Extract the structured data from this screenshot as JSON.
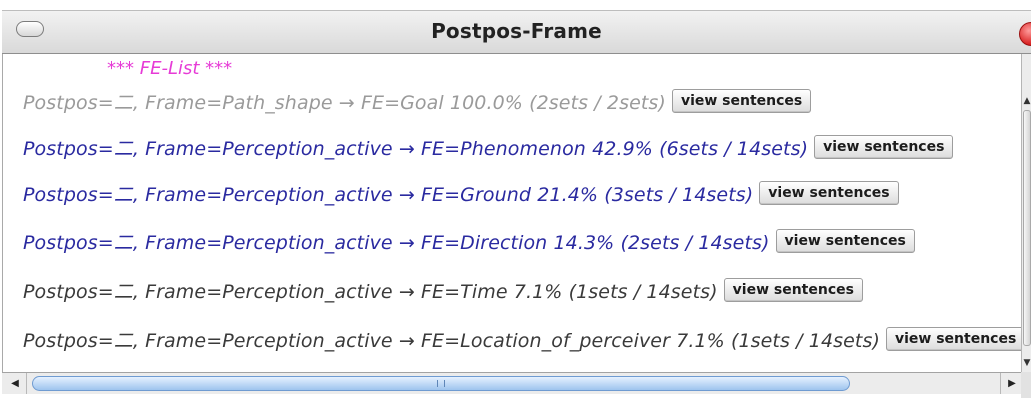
{
  "window": {
    "title": "Postpos-Frame"
  },
  "list": {
    "header": "*** FE-List ***",
    "rows": [
      {
        "text": "Postpos=二, Frame=Path_shape → FE=Goal 100.0% (2sets / 2sets)",
        "button": "view sentences",
        "color": "#9a9a9a"
      },
      {
        "text": "Postpos=二, Frame=Perception_active → FE=Phenomenon 42.9% (6sets / 14sets)",
        "button": "view sentences",
        "color": "#2a2aa0"
      },
      {
        "text": "Postpos=二, Frame=Perception_active → FE=Ground 21.4% (3sets / 14sets)",
        "button": "view sentences",
        "color": "#2a2aa0"
      },
      {
        "text": "Postpos=二, Frame=Perception_active → FE=Direction 14.3% (2sets / 14sets)",
        "button": "view sentences",
        "color": "#2a2aa0"
      },
      {
        "text": "Postpos=二, Frame=Perception_active → FE=Time 7.1% (1sets / 14sets)",
        "button": "view sentences",
        "color": "#3a3a3a"
      },
      {
        "text": "Postpos=二, Frame=Perception_active → FE=Location_of_perceiver 7.1% (1sets / 14sets)",
        "button": "view sentences",
        "color": "#3a3a3a"
      }
    ]
  },
  "colors": {
    "header": "#e63bd6",
    "close_button": "#d82020",
    "scroll_thumb": "#9ec4ee"
  },
  "icons": {
    "window_oval": "window-toolbar-toggle-icon",
    "close": "close-circle-icon",
    "scroll_left": "triangle-left-icon",
    "scroll_right": "triangle-right-icon",
    "scroll_up": "triangle-up-icon",
    "scroll_down": "triangle-down-icon"
  }
}
